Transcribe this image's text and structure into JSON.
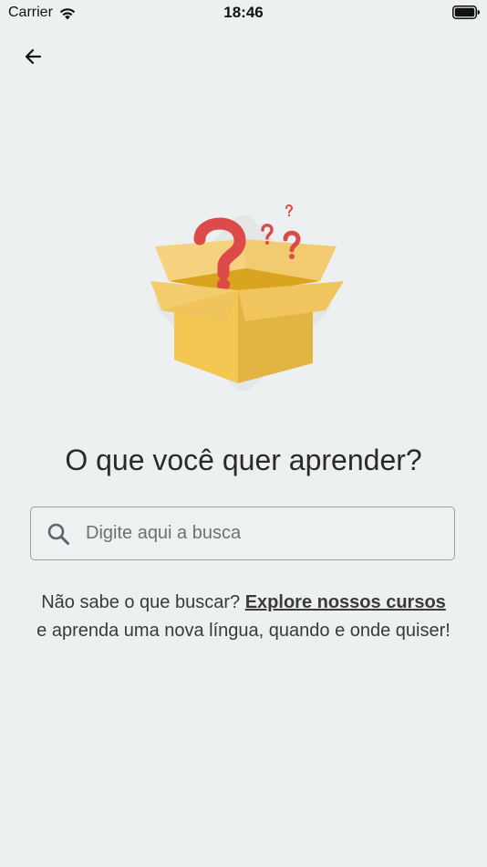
{
  "status_bar": {
    "carrier": "Carrier",
    "time": "18:46"
  },
  "icons": {
    "back": "arrow-left-icon",
    "search": "search-icon",
    "wifi": "wifi-icon",
    "battery": "battery-icon"
  },
  "main": {
    "title": "O que você quer aprender?",
    "search_placeholder": "Digite aqui a busca",
    "helper": {
      "prefix": "Não sabe o que buscar? ",
      "link": "Explore nossos cursos",
      "suffix": " e aprenda uma nova língua, quando e onde quiser!"
    }
  },
  "colors": {
    "background": "#edf0f1",
    "box_yellow": "#f4c652",
    "question_red": "#dc4a4a"
  }
}
